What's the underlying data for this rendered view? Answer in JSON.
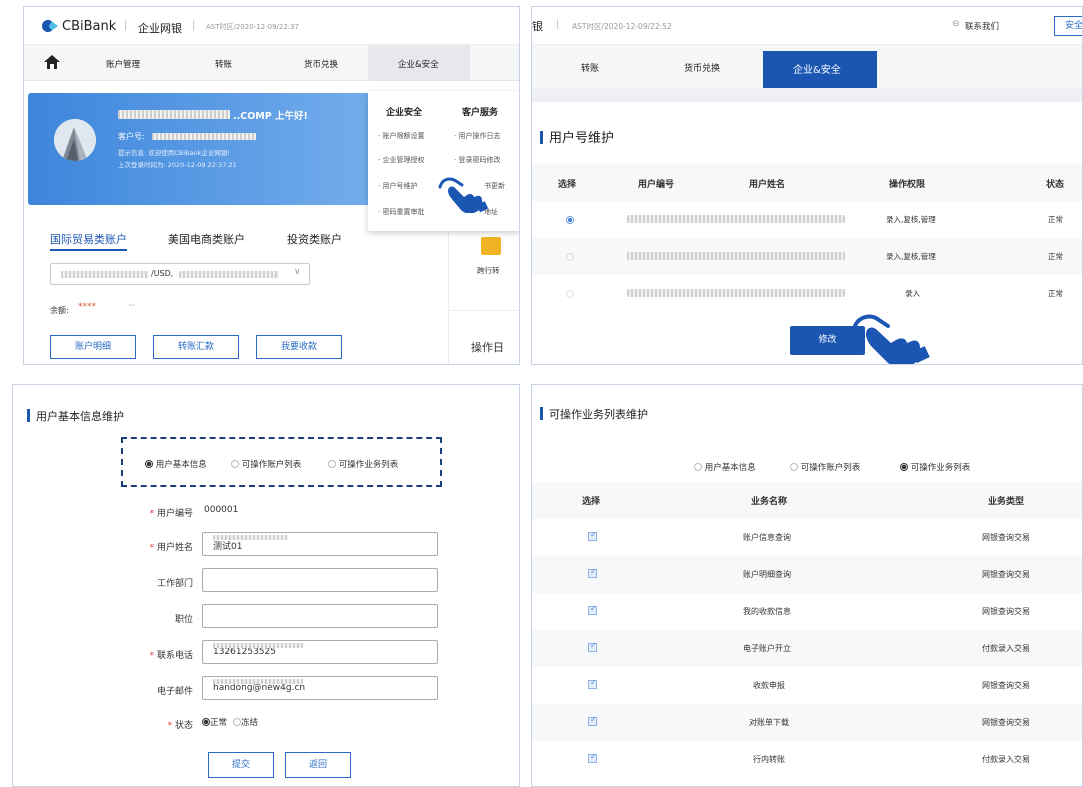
{
  "panel1": {
    "brand": "CBiBank",
    "portal": "企业网银",
    "time": "AST时区/2020-12-09/22:37",
    "nav": [
      "账户管理",
      "转账",
      "货币兑换",
      "企业&安全"
    ],
    "greeting": "..COMP 上午好!",
    "customer_no_label": "客户号:",
    "tip": "提示信息: 欢迎使用CBiBank企业网银!",
    "last_login": "上次登录时间为: 2020-12-09 22:37:21",
    "account_tabs": [
      "国际贸易类账户",
      "美国电商类账户",
      "投资类账户"
    ],
    "account_select_mid": "/USD,",
    "balance_label": "余额:",
    "balance_value": "****",
    "actions": [
      "账户明细",
      "转账汇款",
      "我要收款"
    ],
    "dropdown": {
      "col1_title": "企业安全",
      "col1_items": [
        "账户限额设置",
        "企业管理授权",
        "用户号维护",
        "密码重置审批"
      ],
      "col2_title": "客户服务",
      "col2_items": [
        "用户操作日志",
        "登录密码修改",
        "书更新",
        "地址"
      ]
    },
    "side_label": "跨行转",
    "side_title": "操作日"
  },
  "panel2": {
    "brand_frag": "银",
    "time": "AST时区/2020-12-09/22:52",
    "contact": "联系我们",
    "security_btn": "安全",
    "nav": [
      "转账",
      "货币兑换",
      "企业&安全"
    ],
    "title": "用户号维护",
    "headers": [
      "选择",
      "用户编号",
      "用户姓名",
      "操作权限",
      "状态"
    ],
    "rows": [
      {
        "perm": "录入,复核,管理",
        "status": "正常",
        "selected": true
      },
      {
        "perm": "录入,复核,管理",
        "status": "正常",
        "selected": false
      },
      {
        "perm": "录入",
        "status": "正常",
        "selected": false
      }
    ],
    "modify_btn": "修改"
  },
  "panel3": {
    "title": "用户基本信息维护",
    "radios": [
      "用户基本信息",
      "可操作账户列表",
      "可操作业务列表"
    ],
    "selected_radio": 0,
    "fields": {
      "id_label": "用户编号",
      "id_value": "000001",
      "name_label": "用户姓名",
      "name_value": "测试01",
      "dept_label": "工作部门",
      "pos_label": "职位",
      "phone_label": "联系电话",
      "phone_value": "13261253525",
      "email_label": "电子邮件",
      "email_value": "handong@new4g.cn",
      "status_label": "状态",
      "status_options": [
        "正常",
        "冻结"
      ]
    },
    "submit": "提交",
    "back": "返回"
  },
  "panel4": {
    "title": "可操作业务列表维护",
    "radios": [
      "用户基本信息",
      "可操作账户列表",
      "可操作业务列表"
    ],
    "selected_radio": 2,
    "headers": [
      "选择",
      "业务名称",
      "业务类型"
    ],
    "rows": [
      {
        "name": "账户信息查询",
        "type": "网银查询交易"
      },
      {
        "name": "账户明细查询",
        "type": "网银查询交易"
      },
      {
        "name": "我的收款信息",
        "type": "网银查询交易"
      },
      {
        "name": "电子账户开立",
        "type": "付款录入交易"
      },
      {
        "name": "收款申报",
        "type": "网银查询交易"
      },
      {
        "name": "对账单下载",
        "type": "网银查询交易"
      },
      {
        "name": "行内转账",
        "type": "付款录入交易"
      }
    ]
  },
  "colors": {
    "primary": "#1b56b3",
    "accent": "#3b7fd9",
    "banner": "#4a90e2",
    "required": "#e03b3b"
  }
}
